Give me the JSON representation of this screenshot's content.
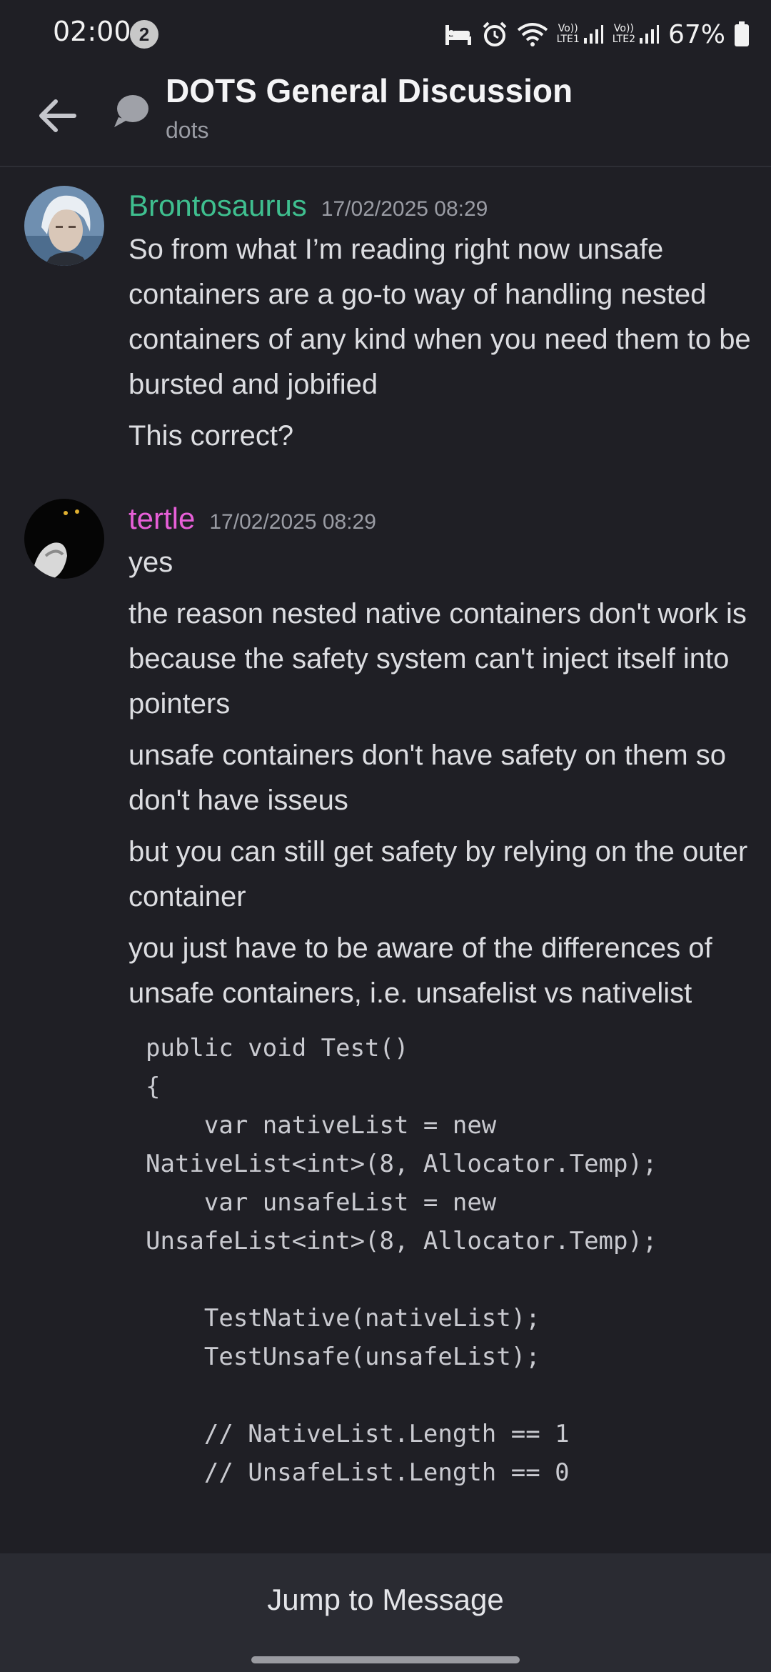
{
  "status_bar": {
    "time": "02:00",
    "notification_count": "2",
    "signal1_label_top": "Vo))",
    "signal1_label_bottom": "LTE1",
    "signal2_label_top": "Vo))",
    "signal2_label_bottom": "LTE2",
    "battery": "67%"
  },
  "header": {
    "title": "DOTS General Discussion",
    "subtitle": "dots"
  },
  "messages": [
    {
      "author": "Brontosaurus",
      "author_color": "#3fbf8f",
      "timestamp": "17/02/2025 08:29",
      "lines": [
        "So from what I’m reading right now unsafe containers are a go-to way of handling nested containers of any kind when you need them to be bursted and jobified",
        "This correct?"
      ]
    },
    {
      "author": "tertle",
      "author_color": "#e75fd8",
      "timestamp": "17/02/2025 08:29",
      "lines": [
        "yes",
        "the reason nested native containers don't work is because the safety system can't inject itself into pointers",
        "unsafe containers don't have safety on them so don't have isseus",
        "but you can still get safety by relying on the outer container",
        "you  just have to be aware of the differences of unsafe containers, i.e. unsafelist vs nativelist"
      ],
      "code": "public void Test()\n{\n    var nativeList = new\nNativeList<int>(8, Allocator.Temp);\n    var unsafeList = new\nUnsafeList<int>(8, Allocator.Temp);\n\n    TestNative(nativeList);\n    TestUnsafe(unsafeList);\n\n    // NativeList.Length == 1\n    // UnsafeList.Length == 0"
    }
  ],
  "footer": {
    "jump_label": "Jump to Message"
  }
}
